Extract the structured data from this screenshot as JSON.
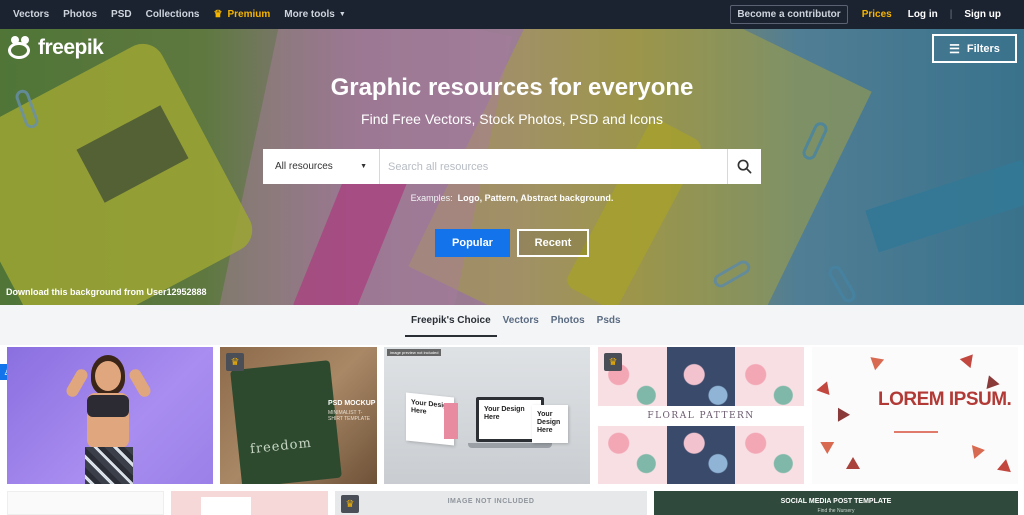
{
  "nav": {
    "links": [
      "Vectors",
      "Photos",
      "PSD",
      "Collections"
    ],
    "premium": "Premium",
    "more": "More tools",
    "contributor": "Become a contributor",
    "prices": "Prices",
    "login": "Log in",
    "separator": "|",
    "signup": "Sign up"
  },
  "hero": {
    "logo": "freepik",
    "filters": "Filters",
    "title": "Graphic resources for everyone",
    "subtitle": "Find Free Vectors, Stock Photos, PSD and Icons",
    "search": {
      "category": "All resources",
      "placeholder": "Search all resources"
    },
    "examples_label": "Examples:",
    "examples": "Logo, Pattern, Abstract background.",
    "btn_popular": "Popular",
    "btn_recent": "Recent",
    "credit": "Download this background from User12952888"
  },
  "tabs": [
    "Freepik's Choice",
    "Vectors",
    "Photos",
    "Psds"
  ],
  "active_tab": "Freepik's Choice",
  "cards": {
    "mockup_label": "PSD MOCKUP",
    "mockup_sub": "MINIMALIST T-SHIRT TEMPLATE",
    "tee_text": "freedom",
    "image_not_included_small": "image preview not included",
    "design_text": "Your Design Here",
    "floral": "FLORAL PATTERN",
    "lorem": "LOREM IPSUM.",
    "image_not_included": "IMAGE NOT INCLUDED",
    "social_title": "SOCIAL MEDIA POST TEMPLATE",
    "social_sub": "Find the Nursery"
  },
  "colors": {
    "nav_bg": "#1c2330",
    "premium": "#f5b400",
    "primary": "#1273eb"
  },
  "icons": [
    "crown-icon",
    "chevron-down-icon",
    "filters-icon",
    "search-icon",
    "caret-down-icon"
  ]
}
